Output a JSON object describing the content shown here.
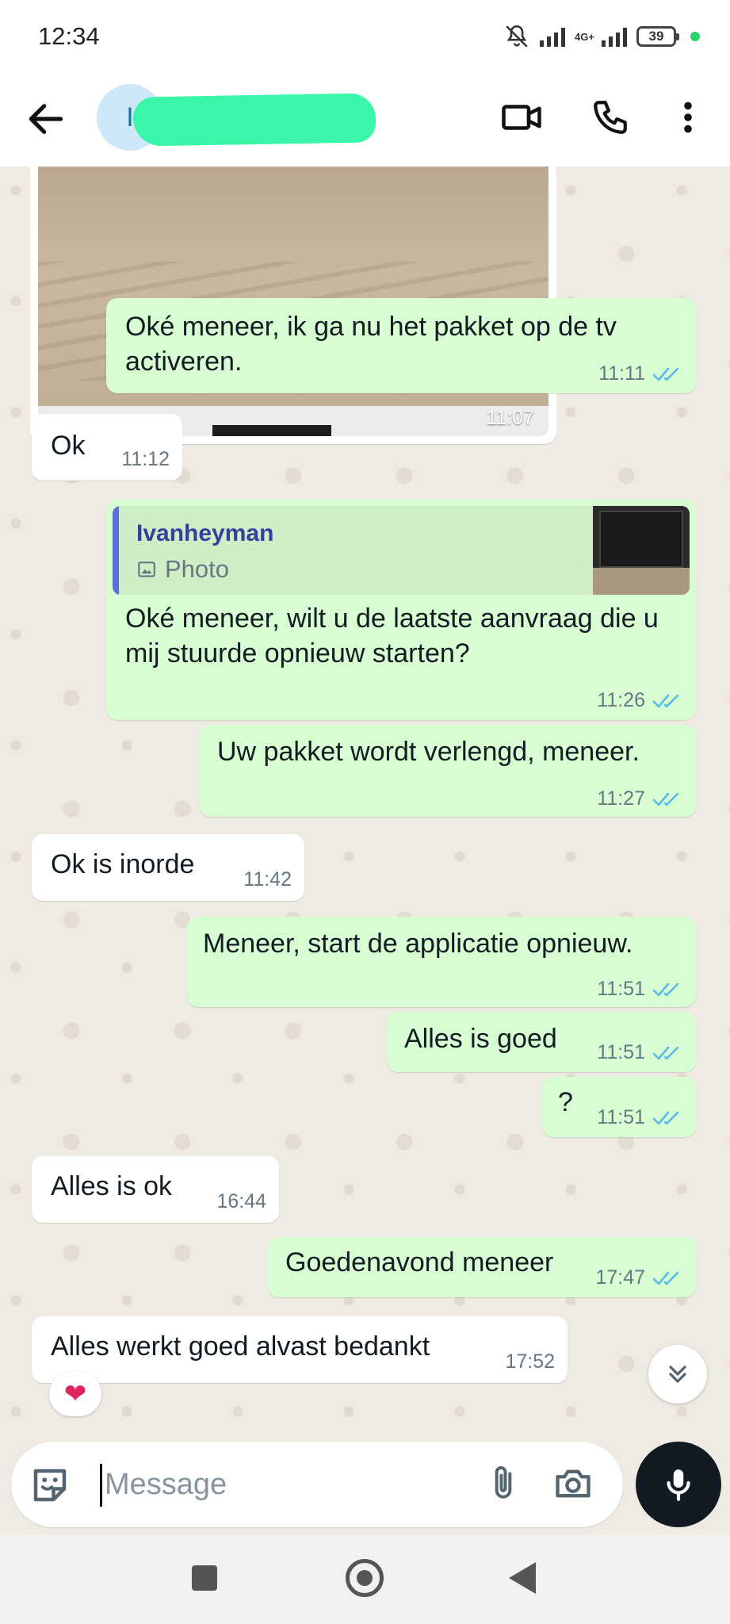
{
  "status_bar": {
    "time": "12:34",
    "network": "4G+",
    "battery": "39"
  },
  "header": {
    "avatar_letter": "I",
    "icons": [
      "back-arrow-icon",
      "video-call-icon",
      "voice-call-icon",
      "more-vert-icon"
    ]
  },
  "photo_message": {
    "time": "11:07"
  },
  "messages": [
    {
      "text": "Oké meneer, ik ga nu het pakket op de tv activeren.",
      "time": "11:11"
    },
    {
      "text": "Ok",
      "time": "11:12"
    },
    {
      "quote_name": "Ivanheyman",
      "quote_type": "Photo",
      "text": "Oké meneer, wilt u de laatste aanvraag die u mij stuurde opnieuw starten?",
      "time": "11:26"
    },
    {
      "text": "Uw pakket wordt verlengd, meneer.",
      "time": "11:27"
    },
    {
      "text": "Ok is inorde",
      "time": "11:42"
    },
    {
      "text": "Meneer, start de applicatie opnieuw.",
      "time": "11:51"
    },
    {
      "text": "Alles is goed",
      "time": "11:51"
    },
    {
      "text": "?",
      "time": "11:51"
    },
    {
      "text": "Alles is ok",
      "time": "16:44"
    },
    {
      "text": "Goedenavond meneer",
      "time": "17:47"
    },
    {
      "text": "Alles werkt goed alvast bedankt",
      "time": "17:52"
    }
  ],
  "reaction": "❤",
  "input": {
    "placeholder": "Message"
  },
  "colors": {
    "outgoing_bubble": "#d9fdd3",
    "incoming_bubble": "#ffffff",
    "read_ticks": "#53bdeb",
    "background": "#efeae2"
  }
}
